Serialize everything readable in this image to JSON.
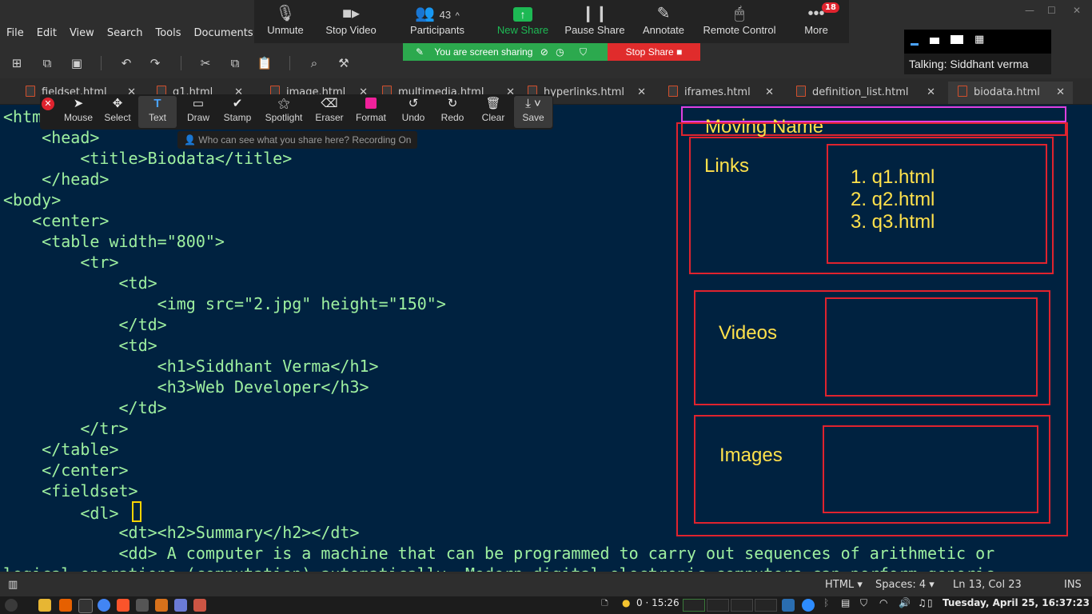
{
  "menu": [
    "File",
    "Edit",
    "View",
    "Search",
    "Tools",
    "Documents"
  ],
  "tabs": [
    {
      "label": "fieldset.html"
    },
    {
      "label": "q1.html"
    },
    {
      "label": "image.html"
    },
    {
      "label": "multimedia.html"
    },
    {
      "label": "hyperlinks.html"
    },
    {
      "label": "iframes.html"
    },
    {
      "label": "definition_list.html"
    },
    {
      "label": "biodata.html",
      "active": true
    }
  ],
  "code": [
    "<html>",
    "    <head>",
    "        <title>Biodata</title>",
    "    </head>",
    "<body>",
    "   <center>",
    "    <table width=\"800\">",
    "        <tr>",
    "            <td>",
    "                <img src=\"2.jpg\" height=\"150\">",
    "            </td>",
    "            <td>",
    "                <h1>Siddhant Verma</h1>",
    "                <h3>Web Developer</h3>",
    "            </td>",
    "        </tr>",
    "    </table>",
    "    </center>",
    "    <fieldset>",
    "        <dl> ",
    "            <dt><h2>Summary</h2></dt>",
    "            <dd> A computer is a machine that can be programmed to carry out sequences of arithmetic or",
    "logical operations (computation) automatically. Modern digital electronic computers can perform generic"
  ],
  "annotations": {
    "moving_name": "Moving Name",
    "links": "Links",
    "links_list": [
      "1. q1.html",
      "2. q2.html",
      "3. q3.html"
    ],
    "videos": "Videos",
    "images": "Images"
  },
  "zoom": {
    "items": [
      {
        "label": "Unmute",
        "icon": "mic-muted-icon"
      },
      {
        "label": "Stop Video",
        "icon": "video-icon"
      },
      {
        "label": "Participants",
        "icon": "participants-icon",
        "count": "43"
      },
      {
        "label": "New Share",
        "icon": "share-up-icon"
      },
      {
        "label": "Pause Share",
        "icon": "pause-icon"
      },
      {
        "label": "Annotate",
        "icon": "pencil-icon"
      },
      {
        "label": "Remote Control",
        "icon": "mouse-icon"
      },
      {
        "label": "More",
        "icon": "more-icon",
        "badge": "18"
      }
    ],
    "sharing_text": "You are screen sharing",
    "stop_share": "Stop Share",
    "talking": "Talking: Siddhant verma"
  },
  "annotate_tools": [
    {
      "label": "Mouse",
      "icon": "arrow-icon"
    },
    {
      "label": "Select",
      "icon": "move-icon"
    },
    {
      "label": "Text",
      "icon": "text-icon",
      "active": true
    },
    {
      "label": "Draw",
      "icon": "rectangle-icon"
    },
    {
      "label": "Stamp",
      "icon": "check-icon"
    },
    {
      "label": "Spotlight",
      "icon": "wand-icon"
    },
    {
      "label": "Eraser",
      "icon": "eraser-icon"
    },
    {
      "label": "Format",
      "icon": "color-swatch-icon"
    },
    {
      "label": "Undo",
      "icon": "undo-icon"
    },
    {
      "label": "Redo",
      "icon": "redo-icon"
    },
    {
      "label": "Clear",
      "icon": "trash-icon"
    },
    {
      "label": "Save",
      "icon": "save-icon"
    }
  ],
  "who_can_see": "Who can see what you share here? Recording On",
  "status": {
    "language": "HTML",
    "spaces": "Spaces: 4",
    "position": "Ln 13, Col 23",
    "mode": "INS"
  },
  "taskbar": {
    "timer": "0 · 15:26",
    "datetime": "Tuesday, April 25, 16:37:23"
  },
  "colors": {
    "editor_bg": "#002240",
    "annotation_red": "#e0232e",
    "annotation_yellow": "#ffe14b",
    "share_green": "#2ca94e",
    "zoom_green": "#1db954"
  }
}
